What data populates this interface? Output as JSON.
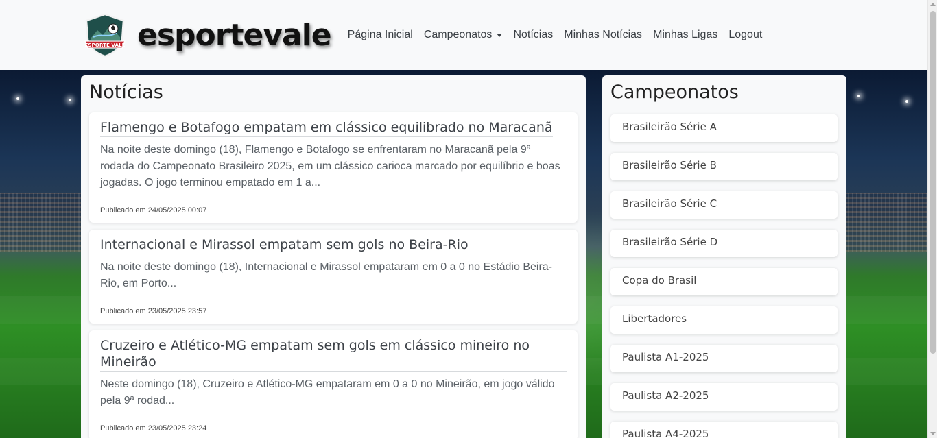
{
  "brand": {
    "name": "esportevale",
    "logo_text": "ESPORTE VALE"
  },
  "nav": {
    "items": [
      {
        "label": "Página Inicial",
        "dropdown": false
      },
      {
        "label": "Campeonatos",
        "dropdown": true
      },
      {
        "label": "Notícias",
        "dropdown": false
      },
      {
        "label": "Minhas Notícias",
        "dropdown": false
      },
      {
        "label": "Minhas Ligas",
        "dropdown": false
      },
      {
        "label": "Logout",
        "dropdown": false
      }
    ]
  },
  "news": {
    "heading": "Notícias",
    "items": [
      {
        "title": "Flamengo e Botafogo empatam em clássico equilibrado no Maracanã",
        "excerpt": "Na noite deste domingo (18), Flamengo e Botafogo se enfrentaram no Maracanã pela 9ª rodada do Campeonato Brasileiro 2025, em um clássico carioca marcado por equilíbrio e boas jogadas. O jogo terminou empatado em 1 a...",
        "date": "Publicado em 24/05/2025 00:07"
      },
      {
        "title": "Internacional e Mirassol empatam sem gols no Beira-Rio",
        "excerpt": "Na noite deste domingo (18), Internacional e Mirassol empataram em 0 a 0 no Estádio Beira-Rio, em Porto...",
        "date": "Publicado em 23/05/2025 23:57"
      },
      {
        "title": "Cruzeiro e Atlético-MG empatam sem gols em clássico mineiro no Mineirão",
        "excerpt": "Neste domingo (18), Cruzeiro e Atlético-MG empataram em 0 a 0 no Mineirão, em jogo válido pela 9ª rodad...",
        "date": "Publicado em 23/05/2025 23:24"
      }
    ]
  },
  "championships": {
    "heading": "Campeonatos",
    "items": [
      "Brasileirão Série A",
      "Brasileirão Série B",
      "Brasileirão Série C",
      "Brasileirão Série D",
      "Copa do Brasil",
      "Libertadores",
      "Paulista A1-2025",
      "Paulista A2-2025",
      "Paulista A4-2025"
    ]
  },
  "colors": {
    "navbar_bg": "#f8f9fa",
    "panel_bg": "#f8f9fa",
    "logo_shield": "#1f4f4a",
    "logo_ribbon": "#c8202a"
  }
}
